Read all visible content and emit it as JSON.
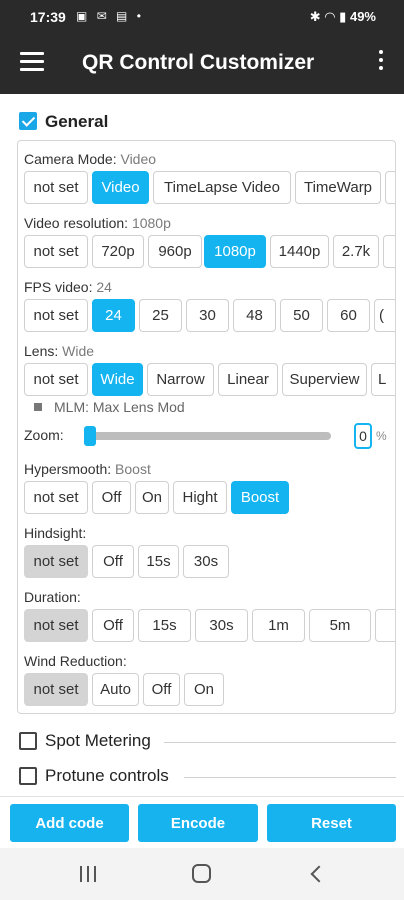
{
  "status_bar": {
    "time": "17:39",
    "notification_icons": "▣ ✉ ▤ •",
    "system_icons": "✱ ◠ ▮",
    "battery": "49%"
  },
  "app_bar": {
    "title": "QR Control Customizer"
  },
  "general": {
    "label": "General",
    "checked": true,
    "groups": [
      {
        "title": "Camera Mode:",
        "value": "Video",
        "options": [
          "not set",
          "Video",
          "TimeLapse Video",
          "TimeWarp",
          ""
        ],
        "selected": 1,
        "selected_style": "blue"
      },
      {
        "title": "Video resolution:",
        "value": "1080p",
        "options": [
          "not set",
          "720p",
          "960p",
          "1080p",
          "1440p",
          "2.7k",
          ""
        ],
        "selected": 3,
        "selected_style": "blue"
      },
      {
        "title": "FPS video:",
        "value": "24",
        "options": [
          "not set",
          "24",
          "25",
          "30",
          "48",
          "50",
          "60",
          "("
        ],
        "selected": 1,
        "selected_style": "blue"
      },
      {
        "title": "Lens:",
        "value": "Wide",
        "options": [
          "not set",
          "Wide",
          "Narrow",
          "Linear",
          "Superview",
          "L"
        ],
        "selected": 1,
        "selected_style": "blue"
      },
      {
        "title": "Hypersmooth:",
        "value": "Boost",
        "options": [
          "not set",
          "Off",
          "On",
          "Hight",
          "Boost"
        ],
        "selected": 4,
        "selected_style": "blue"
      },
      {
        "title": "Hindsight:",
        "value": "",
        "options": [
          "not set",
          "Off",
          "15s",
          "30s"
        ],
        "selected": 0,
        "selected_style": "gray"
      },
      {
        "title": "Duration:",
        "value": "",
        "options": [
          "not set",
          "Off",
          "15s",
          "30s",
          "1m",
          "5m",
          ""
        ],
        "selected": 0,
        "selected_style": "gray"
      },
      {
        "title": "Wind Reduction:",
        "value": "",
        "options": [
          "not set",
          "Auto",
          "Off",
          "On"
        ],
        "selected": 0,
        "selected_style": "gray"
      }
    ],
    "mlm_label": "MLM: Max Lens Mod",
    "zoom": {
      "label": "Zoom:",
      "value": "0",
      "unit": "%",
      "level": 0
    }
  },
  "sections": {
    "spot_metering": {
      "label": "Spot Metering",
      "checked": false
    },
    "protune": {
      "label": "Protune controls",
      "checked": false
    }
  },
  "bottom_buttons": {
    "add_code": "Add code",
    "encode": "Encode",
    "reset": "Reset"
  },
  "colors": {
    "accent": "#14b4f0",
    "app_bar": "#2a2a2a",
    "selected_gray": "#d4d4d4"
  }
}
